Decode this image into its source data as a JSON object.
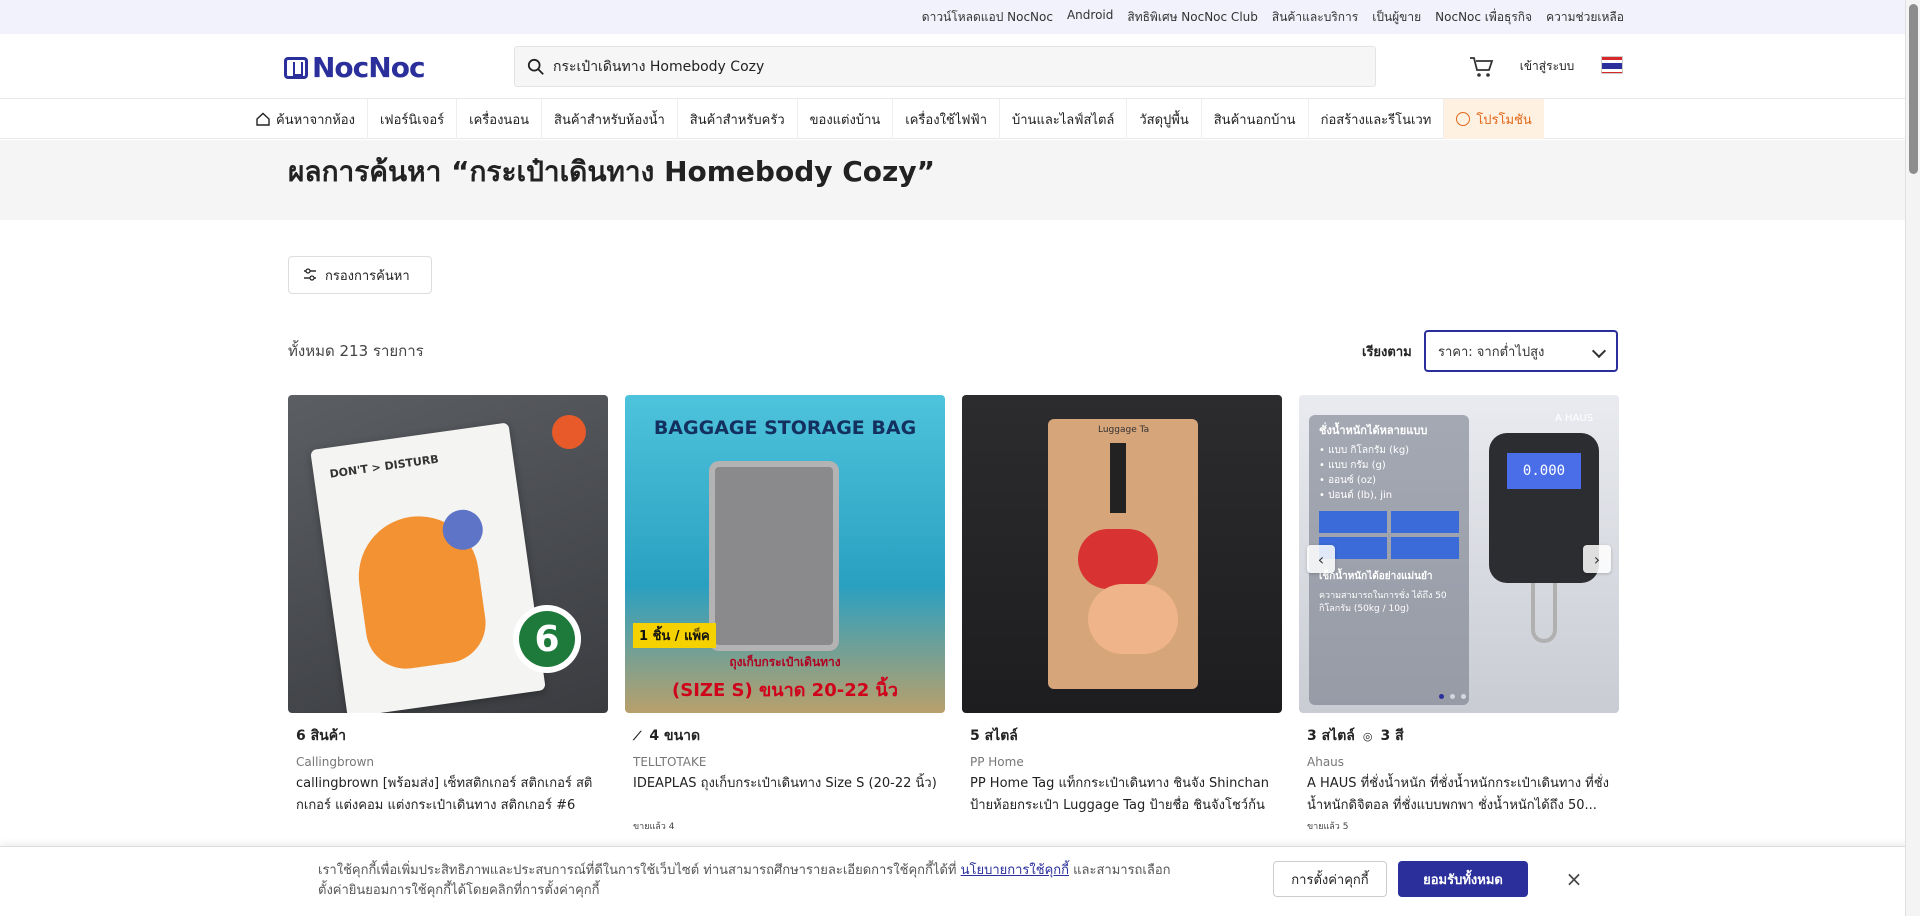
{
  "topbar": {
    "download_app": "ดาวน์โหลดแอป NocNoc",
    "links": [
      "Android",
      "สิทธิพิเศษ NocNoc Club",
      "สินค้าและบริการ",
      "เป็นผู้ขาย",
      "NocNoc เพื่อธุรกิจ",
      "ความช่วยเหลือ"
    ]
  },
  "header": {
    "logo_text": "NocNoc",
    "search_value": "กระเป๋าเดินทาง Homebody Cozy",
    "login_label": "เข้าสู่ระบบ"
  },
  "categories": [
    "ค้นหาจากห้อง",
    "เฟอร์นิเจอร์",
    "เครื่องนอน",
    "สินค้าสำหรับห้องน้ำ",
    "สินค้าสำหรับครัว",
    "ของแต่งบ้าน",
    "เครื่องใช้ไฟฟ้า",
    "บ้านและไลฟ์สไตล์",
    "วัสดุปูพื้น",
    "สินค้านอกบ้าน",
    "ก่อสร้างและรีโนเวท",
    "โปรโมชัน"
  ],
  "page": {
    "title": "ผลการค้นหา “กระเป๋าเดินทาง Homebody Cozy”",
    "filter_label": "กรองการค้นหา",
    "total_label": "ทั้งหมด 213 รายการ",
    "sort_label": "เรียงตาม",
    "sort_value": "ราคา: จากต่ำไปสูง"
  },
  "products": [
    {
      "variant": "6 สินค้า",
      "brand": "Callingbrown",
      "name": "callingbrown [พร้อมส่ง] เซ็ทสติกเกอร์ สติกเกอร์ สติกเกอร์ แต่งคอม แต่งกระเป๋าเดินทาง สติกเกอร์ #6",
      "sold": "",
      "image_text": {
        "sticker": "DON'T > DISTURB",
        "number": "6"
      }
    },
    {
      "variant": "4 ขนาด",
      "brand": "TELLTOTAKE",
      "name": "IDEAPLAS ถุงเก็บกระเป๋าเดินทาง Size S (20-22 นิ้ว)",
      "sold": "ขายแล้ว 4",
      "image_text": {
        "title": "BAGGAGE STORAGE BAG",
        "pack": "1 ชิ้น / แพ็ค",
        "caption": "ถุงเก็บกระเป๋าเดินทาง",
        "size": "(SIZE S) ขนาด 20-22 นิ้ว"
      }
    },
    {
      "variant": "5 สไตล์",
      "brand": "PP Home",
      "name": "PP Home Tag แท็กกระเป๋าเดินทาง ชินจัง Shinchan ป้ายห้อยกระเป๋า Luggage Tag ป้ายชื่อ ชินจังโชว์ก้น",
      "sold": "",
      "image_text": {
        "tag": "Luggage Ta"
      }
    },
    {
      "variant": "3 สไตล์",
      "variant2": "3 สี",
      "brand": "Ahaus",
      "name": "A HAUS ที่ชั่งน้ำหนัก ที่ชั่งน้ำหนักกระเป๋าเดินทาง ที่ชั่งน้ำหนักดิจิตอล ที่ชั่งแบบพกพา ชั่งน้ำหนักได้ถึง 50...",
      "sold": "ขายแล้ว 5",
      "image_text": {
        "h1": "ชั่งน้ำหนักได้หลายแบบ",
        "units": [
          "• แบบ กิโลกรัม (kg)",
          "• แบบ กรัม (g)",
          "• ออนซ์ (oz)",
          "• ปอนด์ (lb), jin"
        ],
        "h2": "เช็กน้ำหนักได้อย่างแม่นยำ",
        "cap": "ความสามารถในการชั่ง ได้ถึง 50 กิโลกรัม (50kg / 10g)",
        "display": "0.000",
        "brand_mark": "A HAUS"
      }
    }
  ],
  "cookie": {
    "message_before": "เราใช้คุกกี้เพื่อเพิ่มประสิทธิภาพและประสบการณ์ที่ดีในการใช้เว็บไซต์ ท่านสามารถศึกษารายละเอียดการใช้คุกกี้ได้ที่ ",
    "policy_link": "นโยบายการใช้คุกกี้",
    "message_after": " และสามารถเลือกตั้งค่ายินยอมการใช้คุกกี้ได้โดยคลิกที่การตั้งค่าคุกกี้",
    "settings_label": "การตั้งค่าคุกกี้",
    "accept_label": "ยอมรับทั้งหมด",
    "close_glyph": "×"
  },
  "colors": {
    "brand": "#2a2f9c",
    "promo": "#e2681a",
    "promo_bg": "#fff1e1"
  }
}
